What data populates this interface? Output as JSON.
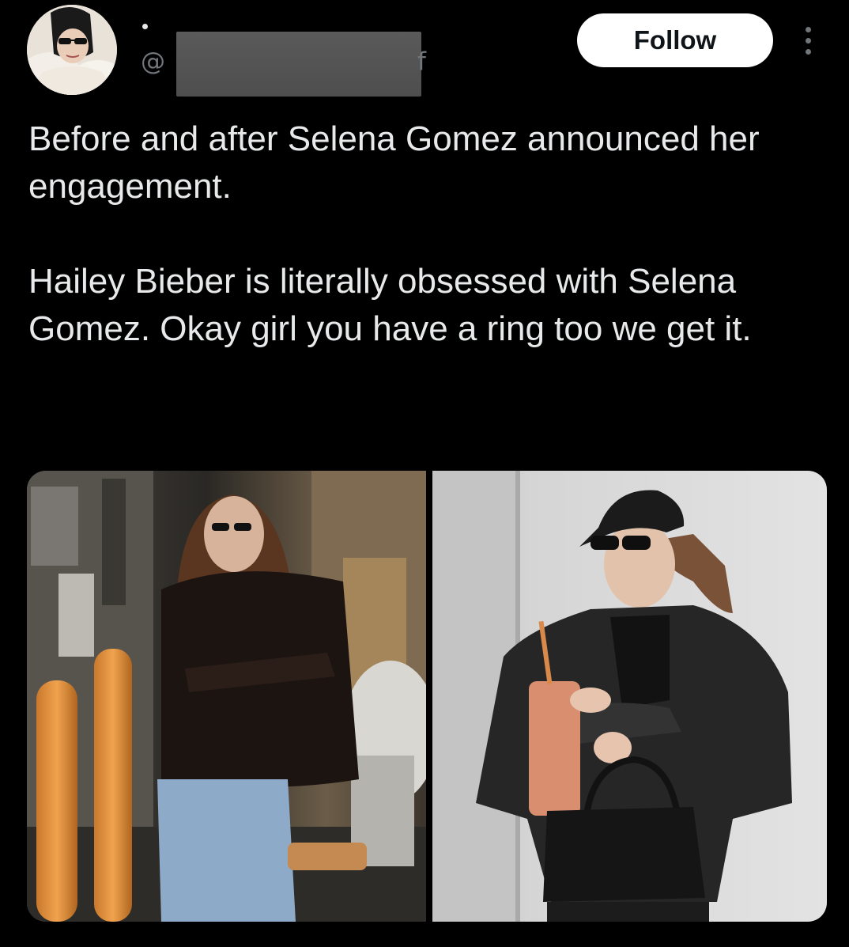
{
  "tweet": {
    "author": {
      "handle_prefix": "@",
      "handle_suffix": "f",
      "avatar_icon": "profile-avatar"
    },
    "follow_label": "Follow",
    "more_icon": "more-vertical-icon",
    "text_paragraphs": [
      "Before and after Selena Gomez announced her engagement.",
      "Hailey Bieber is literally obsessed with Selena Gomez. Okay girl you have a ring too we get it."
    ],
    "media": [
      {
        "kind": "photo",
        "position": "left"
      },
      {
        "kind": "photo",
        "position": "right"
      }
    ]
  },
  "colors": {
    "background": "#000000",
    "text": "#e7e9ea",
    "secondary_text": "#71767b",
    "follow_bg": "#ffffff",
    "follow_text": "#0f1419"
  }
}
